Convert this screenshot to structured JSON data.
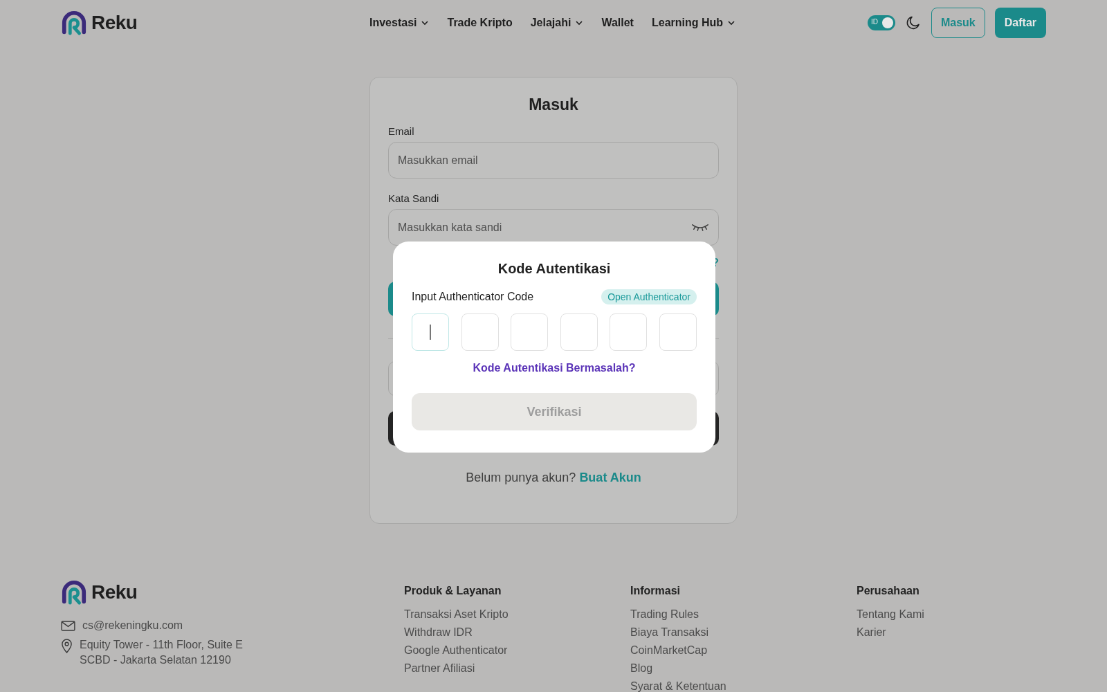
{
  "header": {
    "logo_text": "Reku",
    "nav": [
      {
        "label": "Investasi",
        "has_menu": true
      },
      {
        "label": "Trade Kripto",
        "has_menu": false
      },
      {
        "label": "Jelajahi",
        "has_menu": true
      },
      {
        "label": "Wallet",
        "has_menu": false
      },
      {
        "label": "Learning Hub",
        "has_menu": true
      }
    ],
    "language_toggle": {
      "label": "ID",
      "on": true
    },
    "login_button": "Masuk",
    "register_button": "Daftar"
  },
  "login_card": {
    "title": "Masuk",
    "fields": [
      {
        "label": "Email",
        "placeholder": "Masukkan email",
        "kind": "text"
      },
      {
        "label": "Kata Sandi",
        "placeholder": "Masukkan kata sandi",
        "kind": "password"
      }
    ],
    "forgot_link_tail": "?",
    "signup_prompt": "Belum punya akun?",
    "signup_link": "Buat Akun"
  },
  "modal": {
    "title": "Kode Autentikasi",
    "label": "Input Authenticator Code",
    "open_button": "Open Authenticator",
    "otp_boxes": [
      {
        "focused": true
      },
      {
        "focused": false
      },
      {
        "focused": false
      },
      {
        "focused": false
      },
      {
        "focused": false
      },
      {
        "focused": false
      }
    ],
    "help_link": "Kode Autentikasi Bermasalah?",
    "verify_button": {
      "label": "Verifikasi",
      "disabled": true
    }
  },
  "footer": {
    "logo_text": "Reku",
    "email": "cs@rekeningku.com",
    "address": [
      "Equity Tower - 11th Floor, Suite E",
      "SCBD - Jakarta Selatan 12190"
    ],
    "columns": [
      {
        "title": "Produk & Layanan",
        "links": [
          "Transaksi Aset Kripto",
          "Withdraw IDR",
          "Google Authenticator",
          "Partner Afiliasi"
        ]
      },
      {
        "title": "Informasi",
        "links": [
          "Trading Rules",
          "Biaya Transaksi",
          "CoinMarketCap",
          "Blog",
          "Syarat & Ketentuan"
        ]
      },
      {
        "title": "Perusahaan",
        "links": [
          "Tentang Kami",
          "Karier"
        ]
      }
    ]
  }
}
